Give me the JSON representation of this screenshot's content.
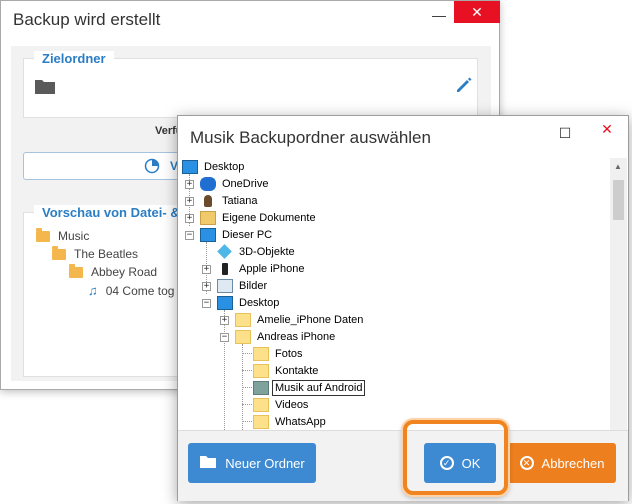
{
  "back_window": {
    "title": "Backup wird erstellt",
    "min_glyph": "—",
    "close_glyph": "✕",
    "zielordner_label": "Zielordner",
    "verfu_text": "Verfü",
    "vor_button_label": "Vor",
    "preview_label": "Vorschau von Datei- &",
    "preview_tree": [
      "Music",
      "The Beatles",
      "Abbey Road",
      "04 Come tog"
    ]
  },
  "dialog": {
    "title": "Musik Backupordner auswählen",
    "max_glyph": "☐",
    "close_glyph": "✕",
    "tree": [
      {
        "label": "Desktop",
        "icon": "monitor-icon"
      },
      {
        "label": "OneDrive",
        "icon": "cloud-icon"
      },
      {
        "label": "Tatiana",
        "icon": "user-icon"
      },
      {
        "label": "Eigene Dokumente",
        "icon": "documents-icon"
      },
      {
        "label": "Dieser PC",
        "icon": "monitor-icon"
      },
      {
        "label": "3D-Objekte",
        "icon": "cube-icon"
      },
      {
        "label": "Apple iPhone",
        "icon": "phone-icon"
      },
      {
        "label": "Bilder",
        "icon": "pictures-icon"
      },
      {
        "label": "Desktop",
        "icon": "monitor-icon"
      },
      {
        "label": "Amelie_iPhone Daten",
        "icon": "folder-icon"
      },
      {
        "label": "Andreas iPhone",
        "icon": "folder-icon"
      },
      {
        "label": "Fotos",
        "icon": "folder-icon"
      },
      {
        "label": "Kontakte",
        "icon": "folder-icon"
      },
      {
        "label": "Musik auf Android",
        "icon": "folder-icon"
      },
      {
        "label": "Videos",
        "icon": "folder-icon"
      },
      {
        "label": "WhatsApp",
        "icon": "folder-icon"
      }
    ],
    "buttons": {
      "new_folder": "Neuer Ordner",
      "ok": "OK",
      "cancel": "Abbrechen"
    }
  },
  "colors": {
    "accent_blue": "#3d8ad3",
    "cancel_orange": "#ee7f1f",
    "highlight_orange": "#ef8420",
    "label_blue": "#2b7dc4"
  }
}
